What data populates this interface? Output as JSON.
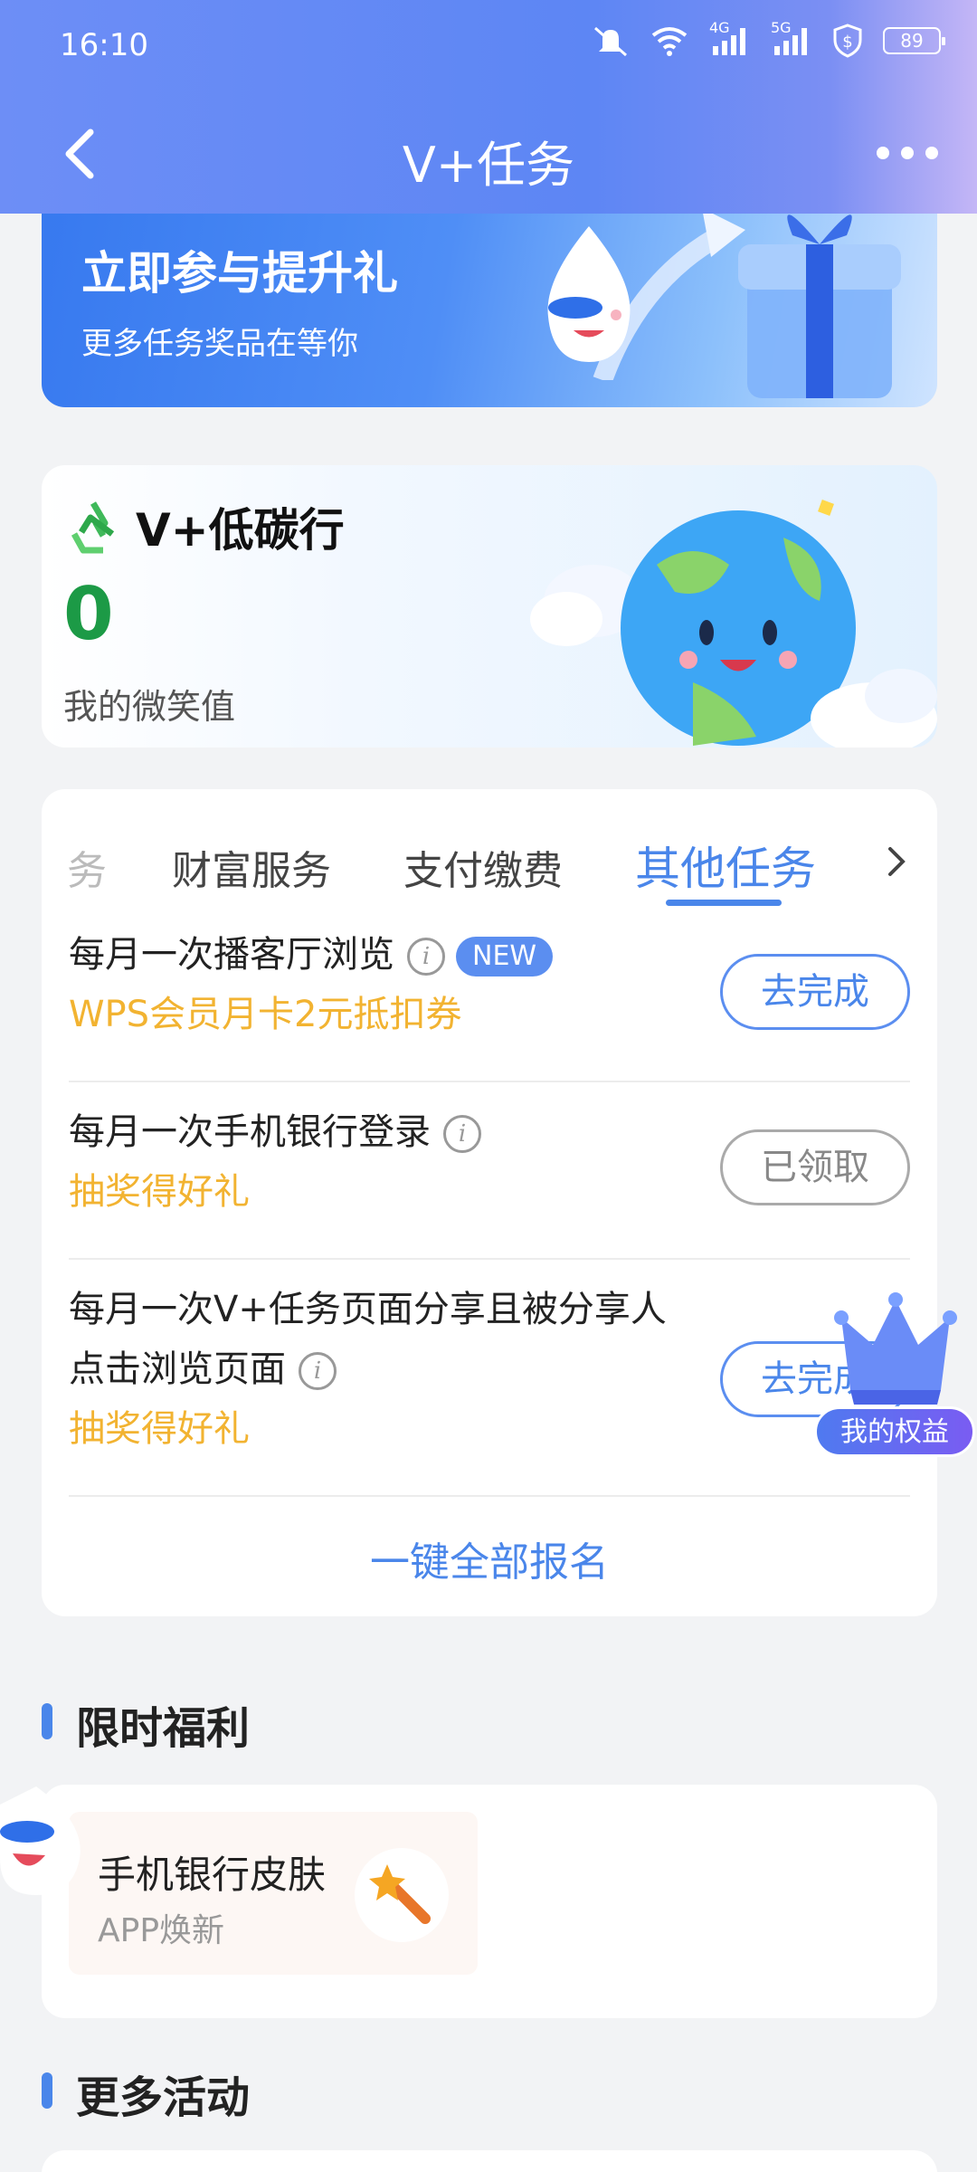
{
  "status_bar": {
    "time": "16:10",
    "network_4g": "4G",
    "network_5g": "5G",
    "battery": "89"
  },
  "nav": {
    "title": "V+任务"
  },
  "banner": {
    "title": "立即参与提升礼",
    "subtitle": "更多任务奖品在等你"
  },
  "carbon": {
    "title": "V+低碳行",
    "value": "0",
    "label": "我的微笑值"
  },
  "tabs": [
    {
      "label": "务"
    },
    {
      "label": "财富服务"
    },
    {
      "label": "支付缴费"
    },
    {
      "label": "其他任务",
      "active": true
    }
  ],
  "tasks": [
    {
      "name": "每月一次播客厅浏览",
      "badge": "NEW",
      "reward": "WPS会员月卡2元抵扣券",
      "button": "去完成"
    },
    {
      "name": "每月一次手机银行登录",
      "reward": "抽奖得好礼",
      "button": "已领取"
    },
    {
      "name_line1": "每月一次V+任务页面分享且被分享人",
      "name_line2": "点击浏览页面",
      "reward": "抽奖得好礼",
      "button": "去完成"
    }
  ],
  "sign_all": "一键全部报名",
  "rights_badge": "我的权益",
  "sections": {
    "welfare": "限时福利",
    "more": "更多活动"
  },
  "welfare_item": {
    "title": "手机银行皮肤",
    "subtitle": "APP焕新"
  },
  "colors": {
    "accent": "#4a86ea",
    "reward": "#f2b331",
    "carbon_value": "#1c9a46"
  }
}
